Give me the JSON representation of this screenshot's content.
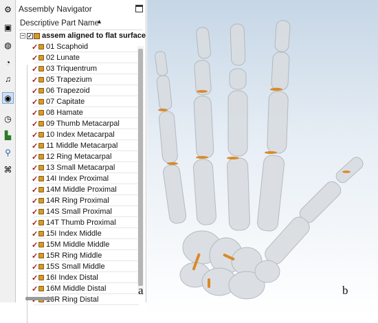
{
  "navigator": {
    "title": "Assembly Navigator",
    "column_header": "Descriptive Part Name",
    "sort_indicator": "▲",
    "root": {
      "expander": "−",
      "checkbox": "✓",
      "label": "assem aligned to flat surface"
    },
    "items": [
      {
        "label": "01 Scaphoid"
      },
      {
        "label": "02 Lunate"
      },
      {
        "label": "03 Triquentrum"
      },
      {
        "label": "05 Trapezium"
      },
      {
        "label": "06 Trapezoid"
      },
      {
        "label": "07 Capitate"
      },
      {
        "label": "08 Hamate"
      },
      {
        "label": "09 Thumb Metacarpal"
      },
      {
        "label": "10 Index Metacarpal"
      },
      {
        "label": "11 Middle Metacarpal"
      },
      {
        "label": "12 Ring Metacarpal"
      },
      {
        "label": "13 Small Metacarpal"
      },
      {
        "label": "14I Index Proximal"
      },
      {
        "label": "14M Middle Proximal"
      },
      {
        "label": "14R Ring Proximal"
      },
      {
        "label": "14S Small Proximal"
      },
      {
        "label": "14T Thumb Proximal"
      },
      {
        "label": "15I Index Middle"
      },
      {
        "label": "15M Middle Middle"
      },
      {
        "label": "15R Ring Middle"
      },
      {
        "label": "15S Small Middle"
      },
      {
        "label": "16I Index Distal"
      },
      {
        "label": "16M Middle Distal"
      },
      {
        "label": "16R Ring Distal"
      }
    ],
    "check_glyph": "✓"
  },
  "panel_labels": {
    "a": "a",
    "b": "b"
  },
  "toolbar": {
    "icons": [
      "gear-icon",
      "assembly-icon",
      "constraint-icon",
      "part-icon",
      "bell-icon",
      "web-icon",
      "history-icon",
      "clock-icon",
      "palette-icon",
      "roles-icon",
      "network-icon"
    ]
  },
  "colors": {
    "bone": "#d9dde1",
    "cartilage": "#d98a2a",
    "check": "#a01818",
    "viewport_top": "#c6d6e6"
  }
}
